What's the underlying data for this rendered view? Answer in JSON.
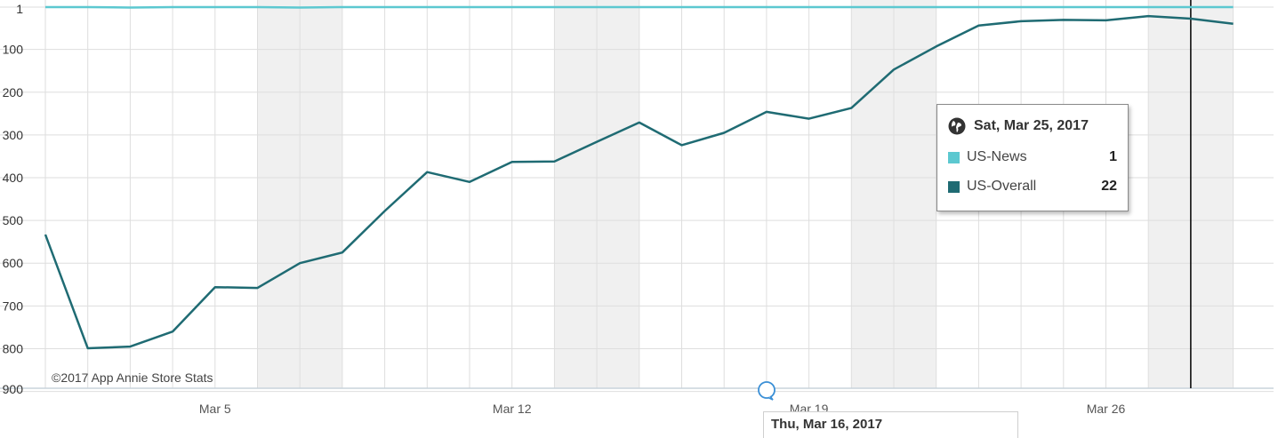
{
  "chart_data": {
    "type": "line",
    "y_reversed": true,
    "ylim": [
      1,
      900
    ],
    "yticks": [
      "1",
      "100",
      "200",
      "300",
      "400",
      "500",
      "600",
      "700",
      "800",
      "900"
    ],
    "ytick_values": [
      1,
      100,
      200,
      300,
      400,
      500,
      600,
      700,
      800,
      900
    ],
    "x_start": "Mar 1",
    "x_labels": [
      {
        "label": "Mar 5",
        "day": 5
      },
      {
        "label": "Mar 12",
        "day": 12
      },
      {
        "label": "Mar 19",
        "day": 19
      },
      {
        "label": "Mar 26",
        "day": 26
      }
    ],
    "weekend_day_pairs": [
      [
        6,
        7
      ],
      [
        13,
        14
      ],
      [
        20,
        21
      ],
      [
        27,
        28
      ]
    ],
    "series": [
      {
        "name": "US-News",
        "color": "#5cc8d0",
        "days": [
          1,
          2,
          3,
          4,
          5,
          6,
          7,
          8,
          9,
          10,
          11,
          12,
          13,
          14,
          15,
          16,
          17,
          18,
          19,
          20,
          21,
          22,
          23,
          24,
          25,
          26,
          27,
          28,
          29
        ],
        "values": [
          1,
          1,
          2,
          1,
          1,
          1,
          2,
          1,
          1,
          1,
          1,
          1,
          1,
          1,
          1,
          1,
          1,
          1,
          1,
          1,
          1,
          1,
          1,
          1,
          1,
          1,
          1,
          1,
          1
        ]
      },
      {
        "name": "US-Overall",
        "color": "#1f6b73",
        "days": [
          1,
          2,
          3,
          4,
          5,
          6,
          7,
          8,
          9,
          10,
          11,
          12,
          13,
          14,
          15,
          16,
          17,
          18,
          19,
          20,
          21,
          22,
          23,
          24,
          25,
          26,
          27,
          28,
          29
        ],
        "values": [
          533,
          799,
          795,
          760,
          656,
          658,
          600,
          575,
          478,
          387,
          410,
          363,
          362,
          316,
          271,
          324,
          295,
          246,
          262,
          237,
          147,
          93,
          44,
          34,
          31,
          32,
          22,
          28,
          40
        ]
      }
    ],
    "credit": "©2017 App Annie Store Stats",
    "crosshair_day": 28,
    "grid": true,
    "legend": "tooltip"
  },
  "tooltip": {
    "date": "Sat, Mar 25, 2017",
    "rows": [
      {
        "name": "US-News",
        "value": "1",
        "color": "#5cc8d0"
      },
      {
        "name": "US-Overall",
        "value": "22",
        "color": "#1f6b73"
      }
    ]
  },
  "secondary_tooltip": {
    "date": "Thu, Mar 16, 2017"
  }
}
